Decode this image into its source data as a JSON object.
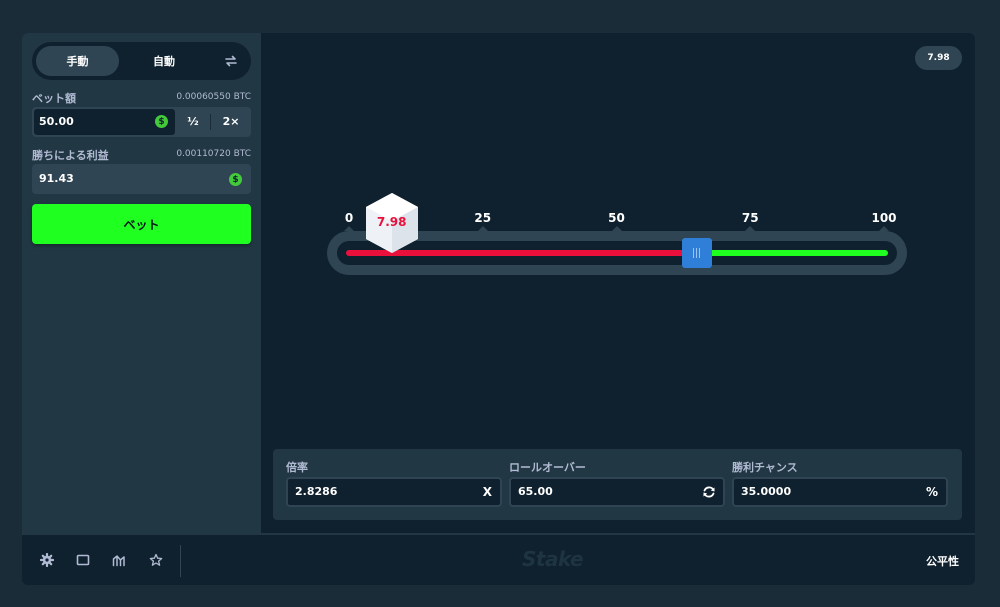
{
  "sidebar": {
    "mode_manual": "手動",
    "mode_auto": "自動",
    "bet_label": "ベット額",
    "bet_btc": "0.00060550 BTC",
    "bet_value": "50.00",
    "half_label": "½",
    "double_label": "2×",
    "profit_label": "勝ちによる利益",
    "profit_btc": "0.00110720 BTC",
    "profit_value": "91.43",
    "coin_symbol": "$",
    "bet_button": "ベット"
  },
  "game": {
    "last_result": "7.98",
    "dice_value": "7.98",
    "dice_position": 7.98,
    "slider_value": 65,
    "ticks": [
      "0",
      "25",
      "50",
      "75",
      "100"
    ],
    "colors": {
      "lose": "#e9113c",
      "win": "#1fff20",
      "handle": "#2f7fd8",
      "accent": "#1fff20"
    }
  },
  "stats": {
    "multiplier_label": "倍率",
    "multiplier_value": "2.8286",
    "multiplier_suffix": "X",
    "roll_label": "ロールオーバー",
    "roll_value": "65.00",
    "roll_icon": "refresh-icon",
    "chance_label": "勝利チャンス",
    "chance_value": "35.0000",
    "chance_suffix": "%"
  },
  "footer": {
    "icons": [
      "gear-icon",
      "screen-icon",
      "stats-chart-icon",
      "star-icon"
    ],
    "logo": "Stake",
    "fairness": "公平性"
  }
}
